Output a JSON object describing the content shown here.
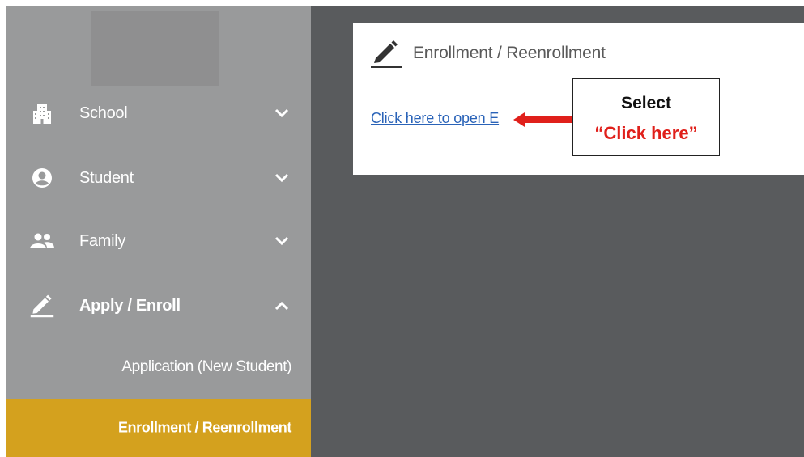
{
  "sidebar": {
    "items": [
      {
        "label": "School",
        "icon": "building-icon",
        "expanded": false
      },
      {
        "label": "Student",
        "icon": "account-circle-icon",
        "expanded": false
      },
      {
        "label": "Family",
        "icon": "people-icon",
        "expanded": false
      },
      {
        "label": "Apply / Enroll",
        "icon": "pencil-icon",
        "expanded": true
      }
    ],
    "subitems": [
      {
        "label": "Application (New Student)",
        "active": false
      },
      {
        "label": "Enrollment / Reenrollment",
        "active": true
      }
    ]
  },
  "main": {
    "card_title": "Enrollment / Reenrollment",
    "link_text": "Click here to open E"
  },
  "callout": {
    "line1": "Select",
    "line2": "“Click here”"
  },
  "colors": {
    "sidebar_bg": "#999a9b",
    "active_bg": "#d4a11e",
    "main_bg": "#595b5d",
    "link": "#2a63b8",
    "callout_red": "#e0201b"
  }
}
